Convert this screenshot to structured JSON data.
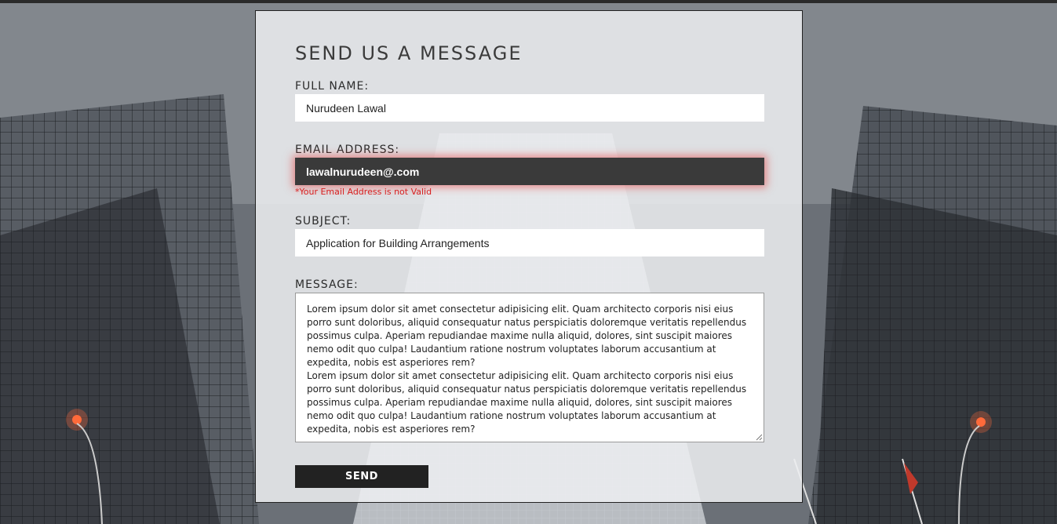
{
  "form": {
    "title": "SEND US A MESSAGE",
    "full_name": {
      "label": "FULL NAME:",
      "value": "Nurudeen Lawal"
    },
    "email": {
      "label": "EMAIL ADDRESS:",
      "value": "lawalnurudeen@.com",
      "error": "*Your Email Address is not Valid"
    },
    "subject": {
      "label": "SUBJECT:",
      "value": "Application for Building Arrangements"
    },
    "message": {
      "label": "MESSAGE:",
      "paragraphs": [
        "Lorem ipsum dolor sit amet consectetur adipisicing elit. Quam architecto corporis nisi eius porro sunt doloribus, aliquid consequatur natus perspiciatis doloremque veritatis repellendus possimus culpa. Aperiam repudiandae maxime nulla aliquid, dolores, sint suscipit maiores nemo odit quo culpa! Laudantium ratione nostrum voluptates laborum accusantium at expedita, nobis est asperiores rem?",
        "Lorem ipsum dolor sit amet consectetur adipisicing elit. Quam architecto corporis nisi eius porro sunt doloribus, aliquid consequatur natus perspiciatis doloremque veritatis repellendus possimus culpa. Aperiam repudiandae maxime nulla aliquid, dolores, sint suscipit maiores nemo odit quo culpa! Laudantium ratione nostrum voluptates laborum accusantium at expedita, nobis est asperiores rem?"
      ]
    },
    "send_label": "SEND"
  },
  "colors": {
    "error": "#d81f1f",
    "button_bg": "#222222",
    "invalid_field_bg": "#3a3a3a"
  },
  "icons": {
    "textarea_resize": "resize-grip-icon"
  }
}
